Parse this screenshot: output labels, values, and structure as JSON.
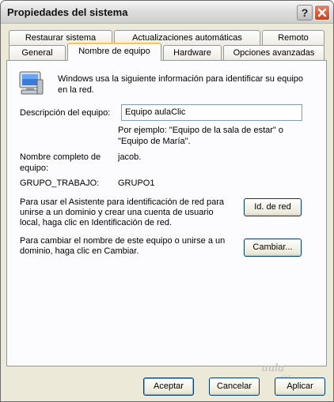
{
  "window": {
    "title": "Propiedades del sistema"
  },
  "titlebar": {
    "help_glyph": "?",
    "close_glyph": "✕"
  },
  "tabs_back": [
    "Restaurar sistema",
    "Actualizaciones automáticas",
    "Remoto"
  ],
  "tabs_front": [
    "General",
    "Nombre de equipo",
    "Hardware",
    "Opciones avanzadas"
  ],
  "active_tab": "Nombre de equipo",
  "panel": {
    "intro": "Windows usa la siguiente información para identificar su equipo en la red.",
    "description_label": "Descripción del equipo:",
    "description_value": "Equipo aulaClic",
    "example": "Por ejemplo: \"Equipo de la sala de estar\" o \"Equipo de María\".",
    "full_name_label": "Nombre completo de equipo:",
    "full_name_value": "jacob.",
    "workgroup_label": "GRUPO_TRABAJO:",
    "workgroup_value": "GRUPO1",
    "network_id_text": "Para usar el Asistente para identificación de red para unirse a un dominio y crear una cuenta de usuario local, haga clic en Identificación de red.",
    "network_id_button": "Id. de red",
    "change_text": "Para cambiar el nombre de este equipo o unirse a un dominio, haga clic en Cambiar.",
    "change_button": "Cambiar..."
  },
  "footer": {
    "ok": "Aceptar",
    "cancel": "Cancelar",
    "apply": "Aplicar"
  },
  "watermark": {
    "line1": "aula",
    "line2": "Clic"
  },
  "colors": {
    "window_bg": "#ece9d8",
    "panel_bg": "#fcfcfe",
    "tab_highlight": "#ffc83c",
    "close_red": "#c6401c"
  }
}
